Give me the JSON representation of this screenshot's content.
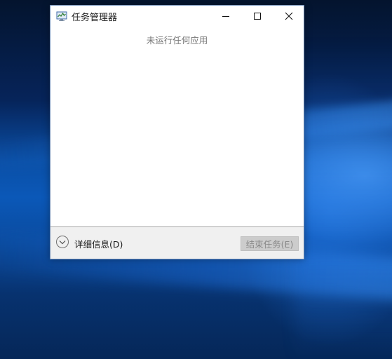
{
  "window": {
    "title": "任务管理器",
    "icon": "task-manager-icon",
    "controls": {
      "minimize": "minimize-icon",
      "maximize": "maximize-icon",
      "close": "close-icon"
    }
  },
  "content": {
    "empty_message": "未运行任何应用"
  },
  "footer": {
    "details_label": "详细信息(D)",
    "details_icon": "chevron-down-circle-icon",
    "end_task_label": "结束任务(E)",
    "end_task_enabled": false
  },
  "colors": {
    "window_border": "#6b8ab5",
    "footer_bg": "#f0f0f0",
    "disabled_button_bg": "#cccccc",
    "disabled_text": "#8a8a8a",
    "desktop_blue": "#0a4fa6"
  }
}
